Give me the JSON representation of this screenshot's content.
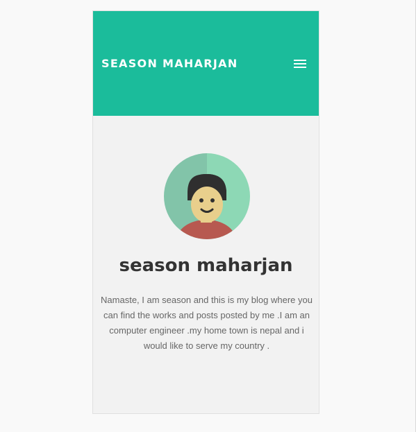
{
  "header": {
    "site_title": "SEASON MAHARJAN",
    "menu_icon": "hamburger-menu-icon",
    "background_color": "#1bbc9b"
  },
  "profile": {
    "avatar_icon": "user-avatar-illustration",
    "name": "season maharjan",
    "bio": "Namaste, I am season and this is my blog where you can find the works and posts posted by me .I am an computer engineer .my home town is nepal and i would like to serve my country ."
  },
  "colors": {
    "accent": "#1bbc9b",
    "page_background": "#f9f9f9",
    "card_background": "#f2f2f2",
    "heading_text": "#333333",
    "body_text": "#666666"
  }
}
